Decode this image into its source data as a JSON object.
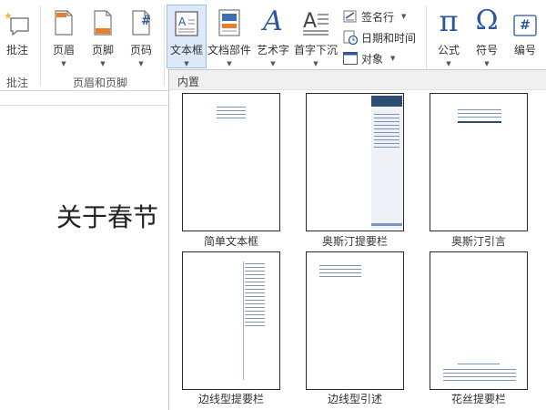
{
  "ribbon": {
    "comment_label": "批注",
    "header_label": "页眉",
    "footer_label": "页脚",
    "page_number_label": "页码",
    "textbox_label": "文本框",
    "quick_parts_label": "文档部件",
    "wordart_label": "艺术字",
    "dropcap_label": "首字下沉",
    "signature_label": "签名行",
    "datetime_label": "日期和时间",
    "object_label": "对象",
    "equation_label": "公式",
    "symbol_label": "符号",
    "number_label": "编号",
    "group_comments": "批注",
    "group_header_footer": "页眉和页脚",
    "wordart_glyph": "A",
    "equation_glyph": "π",
    "symbol_glyph": "Ω",
    "number_glyph": "#",
    "page_number_glyph": "#"
  },
  "document": {
    "visible_text": "关于春节"
  },
  "gallery": {
    "section_title": "内置",
    "items": [
      {
        "label": "简单文本框"
      },
      {
        "label": "奥斯汀提要栏"
      },
      {
        "label": "奥斯汀引言"
      },
      {
        "label": "边线型提要栏"
      },
      {
        "label": "边线型引述"
      },
      {
        "label": "花丝提要栏"
      }
    ]
  },
  "colors": {
    "accent": "#2b579a",
    "active_bg": "#dbe9f8",
    "sample_dark": "#2c4c73"
  },
  "icons": [
    "comment-icon",
    "header-icon",
    "footer-icon",
    "page-number-icon",
    "textbox-icon",
    "quick-parts-icon",
    "wordart-icon",
    "dropcap-icon",
    "signature-icon",
    "datetime-icon",
    "object-icon",
    "equation-icon",
    "symbol-icon",
    "number-icon"
  ]
}
